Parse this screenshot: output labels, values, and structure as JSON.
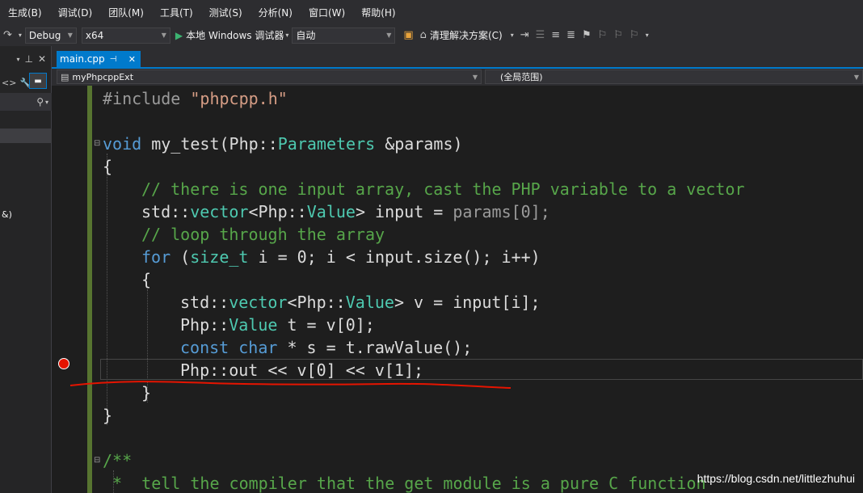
{
  "menu": [
    "生成(B)",
    "调试(D)",
    "团队(M)",
    "工具(T)",
    "测试(S)",
    "分析(N)",
    "窗口(W)",
    "帮助(H)"
  ],
  "toolbar": {
    "config": "Debug",
    "platform": "x64",
    "run_label": "本地 Windows 调试器",
    "auto": "自动",
    "clean_solution": "清理解决方案(C)"
  },
  "left_panel": {
    "fragment": "&)"
  },
  "tab": {
    "label": "main.cpp"
  },
  "navbar": {
    "project": "myPhpcppExt",
    "scope": "(全局范围)"
  },
  "code": {
    "include_kw": "#include",
    "include_file": "\"phpcpp.h\"",
    "void_kw": "void",
    "fn_name": " my_test(",
    "php_ns": "Php::",
    "parameters": "Parameters",
    "amp_params": " &params)",
    "open_brace": "{",
    "close_brace": "}",
    "comment1": "// there is one input array, cast the PHP variable to a vector",
    "std_vector": "std::",
    "vector_kw": "vector",
    "lt": "<",
    "value_kw": "Value",
    "gt": ">",
    "input_assign": " input = ",
    "params_0": "params[0];",
    "comment2": "// loop through the array",
    "for_kw": "for",
    "for_open": " (",
    "size_t": "size_t",
    "for_cond": " i = 0; i < input.size(); i++)",
    "v_assign": " v = input[i];",
    "t_assign": " t = v[0];",
    "const_kw": "const",
    "char_kw": "char",
    "s_assign": " * s = t.rawValue();",
    "out_line": "out << v[0] << v[1];",
    "doc_open": "/**",
    "doc_line": " *  tell the compiler that the get module is a pure C function"
  },
  "watermark": "https://blog.csdn.net/littlezhuhui",
  "colors": {
    "accent": "#007acc",
    "breakpoint": "#e51400",
    "annotation": "#e51400"
  }
}
